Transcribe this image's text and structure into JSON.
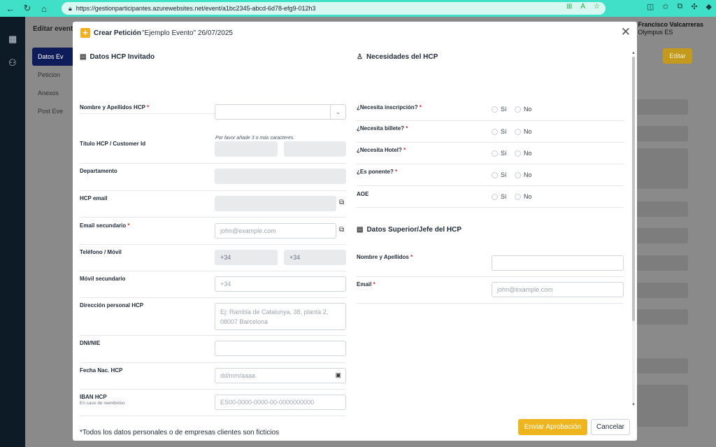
{
  "browser": {
    "url": "https://gestionparticipantes.azurewebsites.net/event/a1bc2345-abcd-6d78-efg9-012h3"
  },
  "app": {
    "page_title": "Editar event",
    "sidebar": [
      "Datos Ev",
      "Peticion",
      "Anexos",
      "Post Eve"
    ],
    "user_name": "Francisco Valcarreras",
    "user_org": "Olympus ES",
    "edit_label": "Editar"
  },
  "modal": {
    "title": "Crear Petición",
    "subtitle": "\"Ejemplo Evento\" 26/07/2025",
    "left_section": "Datos HCP Invitado",
    "right_section": "Necesidades del HCP",
    "superior_section": "Datos Superior/Jefe del HCP",
    "fields": {
      "nombre": {
        "label": "Nombre y Apellidos HCP",
        "help": "Por favor añade 3 o más caracteres."
      },
      "titulo": {
        "label": "Título HCP / Customer Id"
      },
      "departamento": {
        "label": "Departamento"
      },
      "hcp_email": {
        "label": "HCP email"
      },
      "email_sec": {
        "label": "Email secundario",
        "placeholder": "john@example.com"
      },
      "telefono": {
        "label": "Teléfono / Móvil",
        "prefix1": "+34",
        "prefix2": "+34"
      },
      "movil_sec": {
        "label": "Móvil secundario",
        "placeholder": "+34"
      },
      "direccion": {
        "label": "Dirección personal HCP",
        "placeholder": "Ej: Rambla de Catalunya, 38, planta 2, 08007 Barcelona"
      },
      "dni": {
        "label": "DNI/NIE"
      },
      "fecha": {
        "label": "Fecha Nac. HCP",
        "placeholder": "dd/mm/aaaa"
      },
      "iban": {
        "label": "IBAN HCP",
        "hint": "En caso de reembolso",
        "placeholder": "ES00-0000-0000-00-0000000000"
      }
    },
    "needs": [
      {
        "label": "¿Necesita inscripción?",
        "required": true
      },
      {
        "label": "¿Necesita billete?",
        "required": true
      },
      {
        "label": "¿Necesita Hotel?",
        "required": true
      },
      {
        "label": "¿Es ponente?",
        "required": true
      },
      {
        "label": "AOE",
        "required": false
      }
    ],
    "yes": "Sí",
    "no": "No",
    "superior": {
      "name_label": "Nombre y Apellidos",
      "email_label": "Email",
      "email_placeholder": "john@example.com"
    },
    "required_mark": "*",
    "footer_note": "*Todos los datos personales o de empresas clientes son ficticios",
    "send_label": "Enviar Aprobación",
    "cancel_label": "Cancelar"
  }
}
